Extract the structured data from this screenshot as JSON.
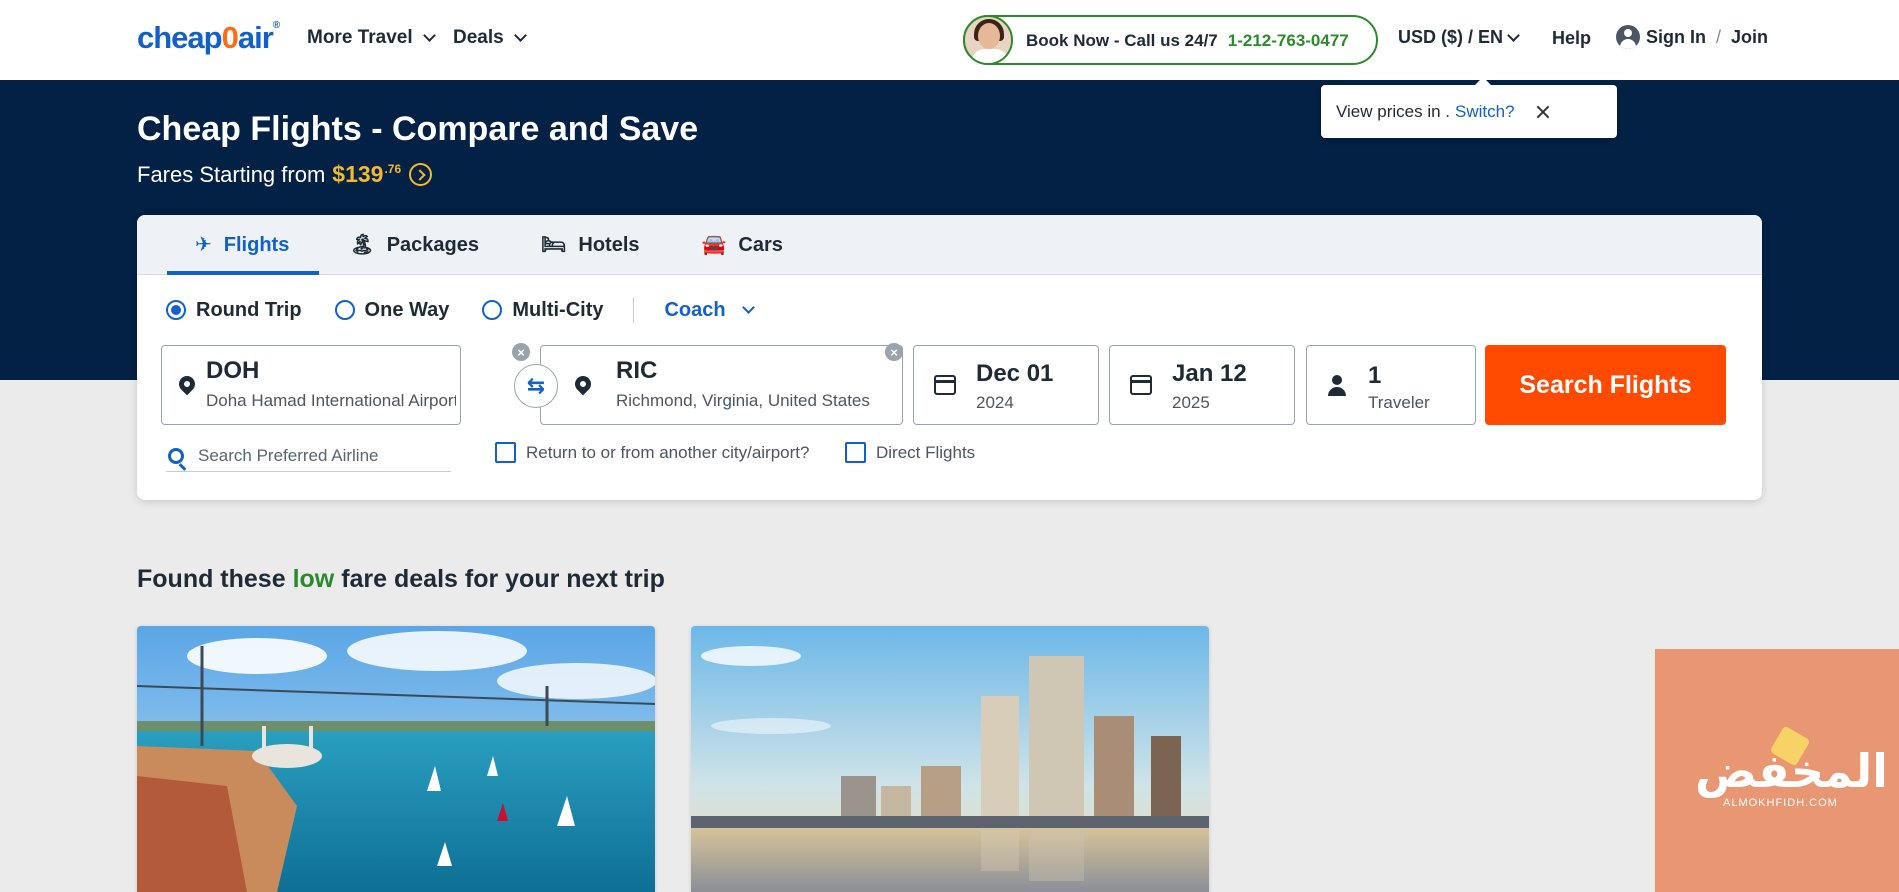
{
  "header": {
    "logo_text_a": "cheap",
    "logo_text_zero": "0",
    "logo_text_b": "air",
    "logo_reg": "®",
    "nav": [
      {
        "label": "More Travel"
      },
      {
        "label": "Deals"
      }
    ],
    "book_now": "Book Now - Call us 24/7",
    "phone": "1-212-763-0477",
    "currency": "USD ($) / EN",
    "help": "Help",
    "sign_in": "Sign In",
    "sep": "/",
    "join": "Join"
  },
  "tooltip": {
    "text": "View prices in .",
    "switch": "Switch?"
  },
  "hero": {
    "title": "Cheap Flights - Compare and Save",
    "fares_label": "Fares Starting from",
    "price_main": "$139",
    "price_cents": ".76"
  },
  "search": {
    "tabs": [
      {
        "label": "Flights",
        "icon": "airplane-icon",
        "glyph": "✈"
      },
      {
        "label": "Packages",
        "icon": "island-icon",
        "glyph": "🏝"
      },
      {
        "label": "Hotels",
        "icon": "bed-icon",
        "glyph": "🛏"
      },
      {
        "label": "Cars",
        "icon": "car-icon",
        "glyph": "🚘"
      }
    ],
    "trip_types": [
      "Round Trip",
      "One Way",
      "Multi-City"
    ],
    "cabin": "Coach",
    "origin": {
      "code": "DOH",
      "name": "Doha Hamad International Airport, ..."
    },
    "destination": {
      "code": "RIC",
      "name": "Richmond, Virginia, United States"
    },
    "depart": {
      "date": "Dec 01",
      "year": "2024"
    },
    "return": {
      "date": "Jan 12",
      "year": "2025"
    },
    "travelers": {
      "count": "1",
      "label": "Traveler"
    },
    "submit": "Search Flights",
    "airline_placeholder": "Search Preferred Airline",
    "return_other": "Return to or from another city/airport?",
    "direct": "Direct Flights",
    "clear_glyph": "×",
    "swap_glyph": "⇆"
  },
  "deals": {
    "title_a": "Found these",
    "title_low": "low",
    "title_b": "fare deals for your next trip"
  },
  "promo": {
    "text": "المخفض",
    "sub": "ALMOKHFIDH.COM"
  },
  "colors": {
    "brand_blue": "#1261c9",
    "hero_navy": "#022145",
    "cta_orange": "#ff4a00",
    "price_gold": "#f5b82e",
    "green": "#2c8a2c"
  }
}
